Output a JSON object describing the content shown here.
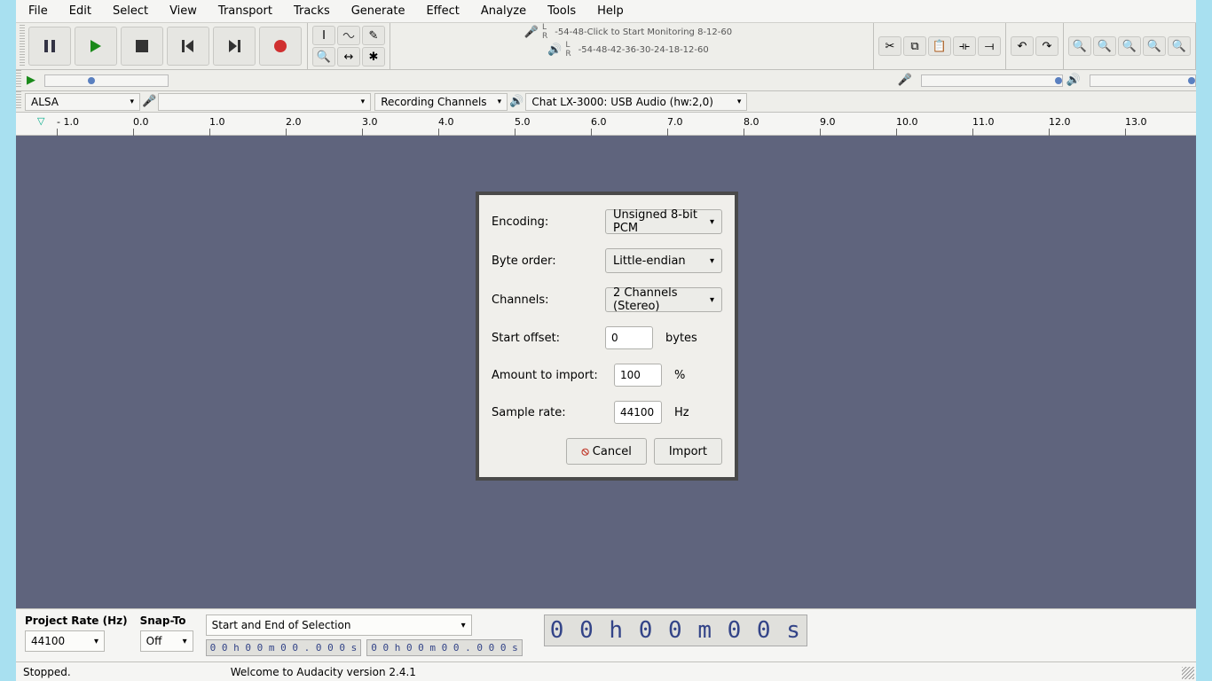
{
  "menu": {
    "file": "File",
    "edit": "Edit",
    "select": "Select",
    "view": "View",
    "transport": "Transport",
    "tracks": "Tracks",
    "generate": "Generate",
    "effect": "Effect",
    "analyze": "Analyze",
    "tools": "Tools",
    "help": "Help"
  },
  "meter": {
    "click_hint": "Click to Start Monitoring 8",
    "ticks_top": [
      "-54",
      "-48",
      "-",
      "",
      "",
      "",
      "",
      "-12",
      "-6",
      "0"
    ],
    "ticks_bot": [
      "-54",
      "-48",
      "-42",
      "-36",
      "-30",
      "-24",
      "-18",
      "-12",
      "-6",
      "0"
    ]
  },
  "device": {
    "host": "ALSA",
    "channels_label": "Recording Channels",
    "output": "Chat LX-3000: USB Audio (hw:2,0)"
  },
  "timeline": {
    "ticks": [
      "- 1.0",
      "0.0",
      "1.0",
      "2.0",
      "3.0",
      "4.0",
      "5.0",
      "6.0",
      "7.0",
      "8.0",
      "9.0",
      "10.0",
      "11.0",
      "12.0",
      "13.0"
    ]
  },
  "bottom": {
    "rate_label": "Project Rate (Hz)",
    "rate_value": "44100",
    "snap_label": "Snap-To",
    "snap_value": "Off",
    "selection_mode": "Start and End of Selection",
    "tc1": "0 0 h 0 0 m 0 0 . 0 0 0 s",
    "tc2": "0 0 h 0 0 m 0 0 . 0 0 0 s",
    "tc_big": "0 0 h 0 0 m 0 0 s"
  },
  "status": {
    "state": "Stopped.",
    "welcome": "Welcome to Audacity version 2.4.1"
  },
  "dialog": {
    "encoding_label": "Encoding:",
    "encoding_value": "Unsigned 8-bit PCM",
    "byteorder_label": "Byte order:",
    "byteorder_value": "Little-endian",
    "channels_label": "Channels:",
    "channels_value": "2 Channels (Stereo)",
    "offset_label": "Start offset:",
    "offset_value": "0",
    "offset_unit": "bytes",
    "amount_label": "Amount to import:",
    "amount_value": "100",
    "amount_unit": "%",
    "rate_label": "Sample rate:",
    "rate_value": "44100",
    "rate_unit": "Hz",
    "cancel": "Cancel",
    "import": "Import"
  }
}
